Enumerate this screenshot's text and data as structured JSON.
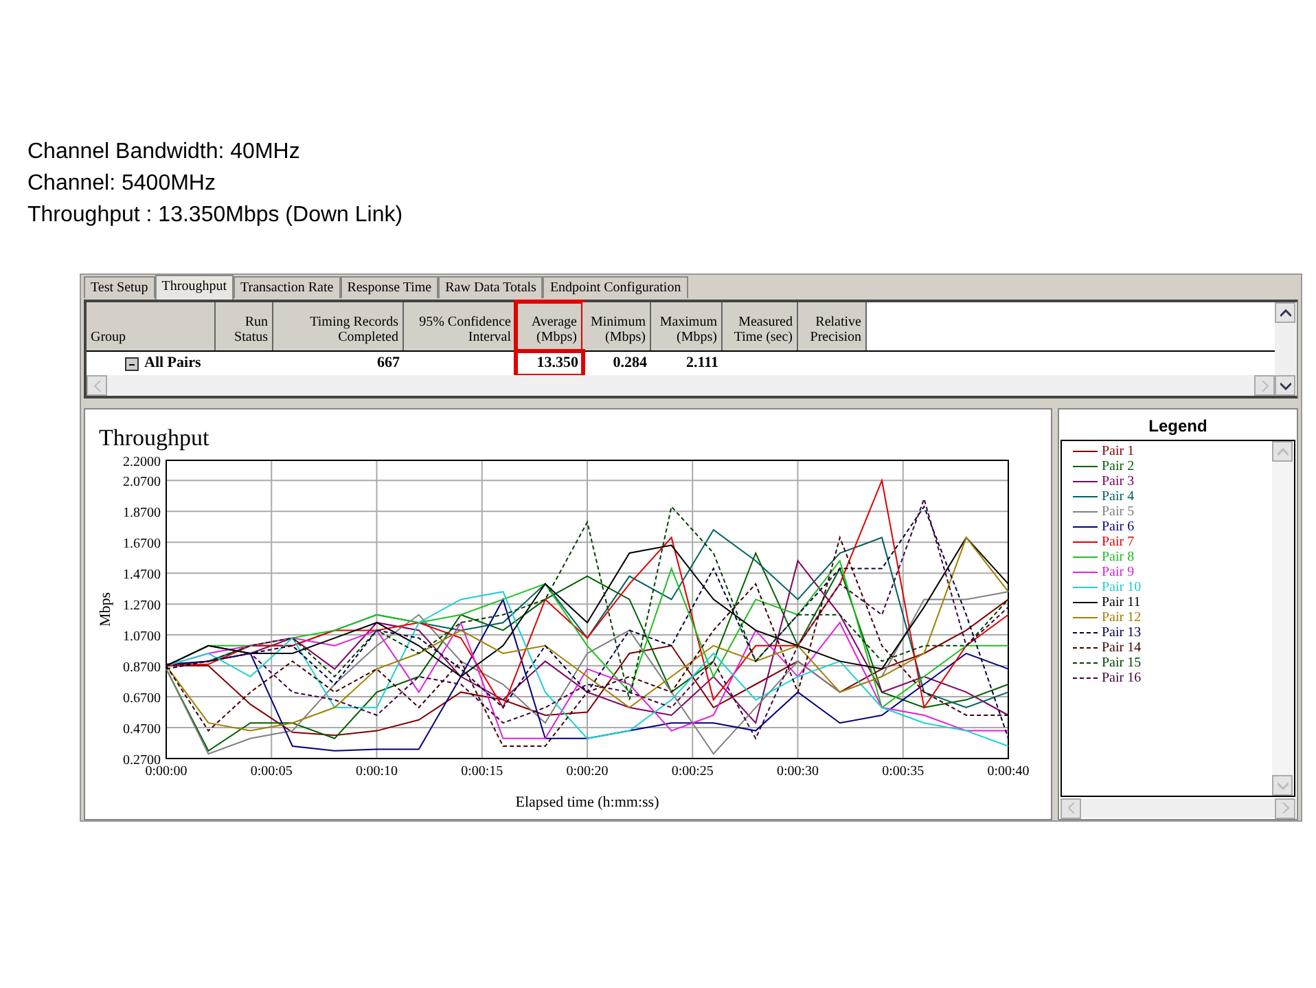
{
  "slide_text": [
    "Channel Bandwidth: 40MHz",
    "Channel: 5400MHz",
    "Throughput : 13.350Mbps (Down Link)"
  ],
  "tabs": [
    {
      "label": "Test Setup",
      "selected": false
    },
    {
      "label": "Throughput",
      "selected": true
    },
    {
      "label": "Transaction Rate",
      "selected": false
    },
    {
      "label": "Response Time",
      "selected": false
    },
    {
      "label": "Raw Data Totals",
      "selected": false
    },
    {
      "label": "Endpoint Configuration",
      "selected": false
    }
  ],
  "table": {
    "columns": [
      {
        "label": "Group",
        "highlighted": false
      },
      {
        "label": "Run Status",
        "highlighted": false
      },
      {
        "label": "Timing Records Completed",
        "highlighted": false
      },
      {
        "label": "95% Confidence Interval",
        "highlighted": false
      },
      {
        "label": "Average (Mbps)",
        "highlighted": true
      },
      {
        "label": "Minimum (Mbps)",
        "highlighted": false
      },
      {
        "label": "Maximum (Mbps)",
        "highlighted": false
      },
      {
        "label": "Measured Time (sec)",
        "highlighted": false
      },
      {
        "label": "Relative Precision",
        "highlighted": false
      }
    ],
    "rows": [
      {
        "expanded": true,
        "cells": [
          "All Pairs",
          null,
          "667",
          null,
          "13.350",
          "0.284",
          "2.111",
          null,
          null
        ]
      }
    ]
  },
  "chart": {
    "chart_data": {
      "type": "line",
      "title": "Throughput",
      "xlabel": "Elapsed time (h:mm:ss)",
      "ylabel": "Mbps",
      "grid": true,
      "x": [
        0,
        2,
        4,
        6,
        8,
        10,
        12,
        14,
        16,
        18,
        20,
        22,
        24,
        26,
        28,
        30,
        32,
        34,
        36,
        38,
        40
      ],
      "xlim": [
        0,
        40
      ],
      "ylim": [
        0.27,
        2.2
      ],
      "xticks": [
        {
          "value": 0,
          "label": "0:00:00"
        },
        {
          "value": 5,
          "label": "0:00:05"
        },
        {
          "value": 10,
          "label": "0:00:10"
        },
        {
          "value": 15,
          "label": "0:00:15"
        },
        {
          "value": 20,
          "label": "0:00:20"
        },
        {
          "value": 25,
          "label": "0:00:25"
        },
        {
          "value": 30,
          "label": "0:00:30"
        },
        {
          "value": 35,
          "label": "0:00:35"
        },
        {
          "value": 40,
          "label": "0:00:40"
        }
      ],
      "yticks": [
        {
          "value": 0.27,
          "label": "0.2700"
        },
        {
          "value": 0.47,
          "label": "0.4700"
        },
        {
          "value": 0.67,
          "label": "0.6700"
        },
        {
          "value": 0.87,
          "label": "0.8700"
        },
        {
          "value": 1.07,
          "label": "1.0700"
        },
        {
          "value": 1.27,
          "label": "1.2700"
        },
        {
          "value": 1.47,
          "label": "1.4700"
        },
        {
          "value": 1.67,
          "label": "1.6700"
        },
        {
          "value": 1.87,
          "label": "1.8700"
        },
        {
          "value": 2.07,
          "label": "2.0700"
        },
        {
          "value": 2.2,
          "label": "2.2000"
        }
      ],
      "series": [
        {
          "name": "Pair 1",
          "color": "#800000",
          "line_style": "solid",
          "values": [
            0.87,
            0.87,
            0.62,
            0.44,
            0.42,
            0.45,
            0.52,
            0.7,
            0.65,
            0.55,
            0.57,
            0.95,
            1.0,
            0.6,
            0.75,
            0.9,
            0.7,
            0.85,
            0.95,
            1.1,
            1.3
          ]
        },
        {
          "name": "Pair 2",
          "color": "#006000",
          "line_style": "solid",
          "values": [
            0.85,
            0.32,
            0.5,
            0.5,
            0.4,
            0.7,
            0.8,
            1.2,
            1.1,
            1.3,
            1.45,
            1.3,
            0.7,
            0.9,
            1.6,
            1.0,
            1.5,
            0.7,
            0.6,
            0.65,
            0.75
          ]
        },
        {
          "name": "Pair 3",
          "color": "#800060",
          "line_style": "solid",
          "values": [
            0.87,
            1.0,
            0.95,
            1.05,
            0.85,
            1.15,
            1.1,
            0.8,
            0.65,
            0.9,
            0.7,
            0.6,
            0.55,
            0.8,
            0.5,
            1.55,
            1.2,
            0.7,
            0.8,
            0.7,
            0.55
          ]
        },
        {
          "name": "Pair 4",
          "color": "#006060",
          "line_style": "solid",
          "values": [
            0.87,
            0.9,
            1.0,
            1.0,
            1.1,
            1.2,
            1.15,
            1.1,
            1.15,
            1.4,
            1.05,
            1.45,
            1.3,
            1.75,
            1.55,
            1.3,
            1.6,
            1.7,
            0.7,
            0.6,
            0.7
          ]
        },
        {
          "name": "Pair 5",
          "color": "#808080",
          "line_style": "solid",
          "values": [
            0.85,
            0.3,
            0.4,
            0.45,
            0.75,
            1.0,
            1.2,
            0.9,
            0.75,
            0.5,
            0.95,
            1.1,
            0.7,
            0.3,
            0.6,
            0.9,
            0.7,
            0.8,
            1.3,
            1.3,
            1.35
          ]
        },
        {
          "name": "Pair 6",
          "color": "#000080",
          "line_style": "solid",
          "values": [
            0.88,
            0.9,
            0.95,
            0.35,
            0.32,
            0.33,
            0.33,
            0.8,
            1.3,
            0.4,
            0.4,
            0.45,
            0.5,
            0.5,
            0.45,
            0.7,
            0.5,
            0.55,
            0.75,
            0.95,
            0.85
          ]
        },
        {
          "name": "Pair 7",
          "color": "#e00000",
          "line_style": "solid",
          "values": [
            0.87,
            0.88,
            1.0,
            1.0,
            1.1,
            1.1,
            1.15,
            1.05,
            0.6,
            1.3,
            1.05,
            1.4,
            1.7,
            0.65,
            1.0,
            1.0,
            1.4,
            2.07,
            0.6,
            1.0,
            1.2
          ]
        },
        {
          "name": "Pair 8",
          "color": "#20c020",
          "line_style": "solid",
          "values": [
            0.87,
            1.0,
            1.0,
            1.05,
            1.1,
            1.2,
            1.15,
            1.2,
            1.3,
            1.4,
            1.0,
            0.7,
            1.5,
            0.8,
            1.3,
            1.2,
            1.55,
            0.6,
            0.8,
            1.0,
            1.0
          ]
        },
        {
          "name": "Pair 9",
          "color": "#e020e0",
          "line_style": "solid",
          "values": [
            0.87,
            0.95,
            1.0,
            1.05,
            1.0,
            1.1,
            0.7,
            1.15,
            0.4,
            0.4,
            0.85,
            0.75,
            0.45,
            0.55,
            1.1,
            0.8,
            1.15,
            0.6,
            0.55,
            0.45,
            0.45
          ]
        },
        {
          "name": "Pair 10",
          "color": "#20d0d0",
          "line_style": "solid",
          "values": [
            0.87,
            0.95,
            0.8,
            1.05,
            0.6,
            0.6,
            1.15,
            1.3,
            1.35,
            0.7,
            0.4,
            0.45,
            0.65,
            0.95,
            0.65,
            0.8,
            0.9,
            0.6,
            0.5,
            0.45,
            0.35
          ]
        },
        {
          "name": "Pair 11",
          "color": "#000000",
          "line_style": "solid",
          "values": [
            0.87,
            1.0,
            0.95,
            0.95,
            1.05,
            1.15,
            1.0,
            0.8,
            1.0,
            1.4,
            1.15,
            1.6,
            1.65,
            1.3,
            1.1,
            1.0,
            0.9,
            0.85,
            1.25,
            1.7,
            1.4
          ]
        },
        {
          "name": "Pair 12",
          "color": "#a08000",
          "line_style": "solid",
          "values": [
            0.87,
            0.5,
            0.45,
            0.5,
            0.6,
            0.85,
            0.95,
            1.1,
            0.95,
            1.0,
            0.8,
            0.6,
            0.8,
            1.0,
            0.9,
            1.0,
            0.7,
            0.8,
            0.95,
            1.7,
            1.35
          ]
        },
        {
          "name": "Pair 13",
          "color": "#000040",
          "line_style": "dashed",
          "values": [
            0.85,
            0.9,
            0.95,
            1.0,
            0.75,
            1.1,
            1.05,
            0.85,
            0.6,
            1.0,
            0.7,
            1.1,
            1.0,
            1.5,
            0.9,
            1.2,
            1.5,
            1.5,
            1.9,
            1.2,
            0.4
          ]
        },
        {
          "name": "Pair 14",
          "color": "#400000",
          "line_style": "dashed",
          "values": [
            0.87,
            0.45,
            0.7,
            0.9,
            0.7,
            0.85,
            0.6,
            0.9,
            0.35,
            0.35,
            0.7,
            0.8,
            0.7,
            1.1,
            1.4,
            0.7,
            1.7,
            1.0,
            0.7,
            0.55,
            0.55
          ]
        },
        {
          "name": "Pair 15",
          "color": "#004000",
          "line_style": "dashed",
          "values": [
            0.87,
            0.9,
            1.0,
            1.05,
            0.8,
            1.1,
            0.95,
            1.15,
            1.2,
            1.3,
            1.8,
            0.65,
            1.9,
            1.6,
            0.9,
            1.2,
            1.2,
            0.9,
            1.0,
            1.0,
            1.3
          ]
        },
        {
          "name": "Pair 16",
          "color": "#400040",
          "line_style": "dashed",
          "values": [
            0.87,
            0.9,
            0.95,
            0.7,
            0.65,
            0.55,
            0.8,
            0.75,
            0.5,
            0.6,
            0.75,
            0.7,
            0.6,
            0.9,
            0.4,
            1.0,
            1.4,
            1.2,
            1.95,
            1.0,
            1.25
          ]
        }
      ]
    }
  },
  "legend": {
    "title": "Legend"
  }
}
